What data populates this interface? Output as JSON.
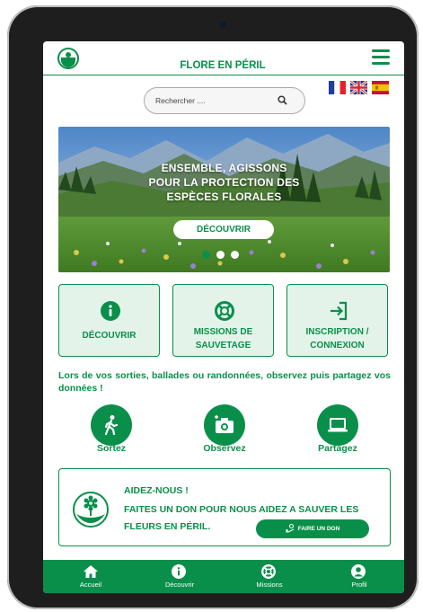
{
  "app": {
    "title": "FLORE EN PÉRIL"
  },
  "languages": [
    {
      "code": "fr",
      "icon": "flag-france-icon"
    },
    {
      "code": "en",
      "icon": "flag-uk-icon"
    },
    {
      "code": "es",
      "icon": "flag-spain-icon"
    }
  ],
  "search": {
    "placeholder": "Rechercher ...."
  },
  "hero": {
    "line1": "ENSEMBLE, AGISSONS",
    "line2": "POUR LA PROTECTION DES",
    "line3": "ESPÈCES FLORALES",
    "button": "DÉCOUVRIR",
    "slide_count": 3,
    "active_slide": 1
  },
  "tiles": [
    {
      "label1": "DÉCOUVRIR",
      "label2": "",
      "icon": "info-icon"
    },
    {
      "label1": "MISSIONS DE",
      "label2": "SAUVETAGE",
      "icon": "lifebuoy-icon"
    },
    {
      "label1": "INSCRIPTION /",
      "label2": "CONNEXION",
      "icon": "sign-in-icon"
    }
  ],
  "intro": "Lors de vos sorties, ballades ou randonnées, observez puis partagez vos données !",
  "actions": [
    {
      "label": "Sortez",
      "icon": "walking-person-icon"
    },
    {
      "label": "Observez",
      "icon": "camera-icon"
    },
    {
      "label": "Partagez",
      "icon": "laptop-icon"
    }
  ],
  "donation": {
    "title": "AIDEZ-NOUS !",
    "text": "FAITES UN DON POUR NOUS AIDEZ A SAUVER LES FLEURS EN PÉRIL.",
    "button": "FAIRE UN DON"
  },
  "tabbar": [
    {
      "label": "Accueil",
      "icon": "home-icon"
    },
    {
      "label": "Découvrir",
      "icon": "info-icon"
    },
    {
      "label": "Missions",
      "icon": "lifebuoy-icon"
    },
    {
      "label": "Profil",
      "icon": "user-icon"
    }
  ],
  "colors": {
    "primary": "#0a8f4a",
    "tile_bg": "#e3f3ea"
  }
}
